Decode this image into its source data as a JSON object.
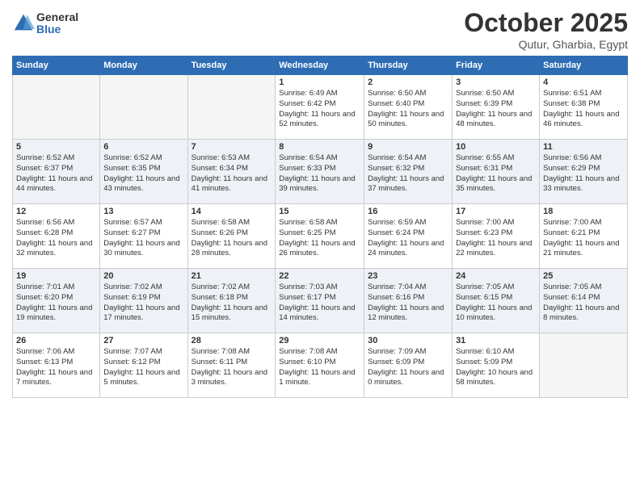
{
  "header": {
    "logo_general": "General",
    "logo_blue": "Blue",
    "month": "October 2025",
    "location": "Qutur, Gharbia, Egypt"
  },
  "weekdays": [
    "Sunday",
    "Monday",
    "Tuesday",
    "Wednesday",
    "Thursday",
    "Friday",
    "Saturday"
  ],
  "rows": [
    {
      "cells": [
        {
          "empty": true
        },
        {
          "empty": true
        },
        {
          "empty": true
        },
        {
          "day": "1",
          "sunrise": "6:49 AM",
          "sunset": "6:42 PM",
          "daylight": "11 hours and 52 minutes."
        },
        {
          "day": "2",
          "sunrise": "6:50 AM",
          "sunset": "6:40 PM",
          "daylight": "11 hours and 50 minutes."
        },
        {
          "day": "3",
          "sunrise": "6:50 AM",
          "sunset": "6:39 PM",
          "daylight": "11 hours and 48 minutes."
        },
        {
          "day": "4",
          "sunrise": "6:51 AM",
          "sunset": "6:38 PM",
          "daylight": "11 hours and 46 minutes."
        }
      ]
    },
    {
      "cells": [
        {
          "day": "5",
          "sunrise": "6:52 AM",
          "sunset": "6:37 PM",
          "daylight": "11 hours and 44 minutes."
        },
        {
          "day": "6",
          "sunrise": "6:52 AM",
          "sunset": "6:35 PM",
          "daylight": "11 hours and 43 minutes."
        },
        {
          "day": "7",
          "sunrise": "6:53 AM",
          "sunset": "6:34 PM",
          "daylight": "11 hours and 41 minutes."
        },
        {
          "day": "8",
          "sunrise": "6:54 AM",
          "sunset": "6:33 PM",
          "daylight": "11 hours and 39 minutes."
        },
        {
          "day": "9",
          "sunrise": "6:54 AM",
          "sunset": "6:32 PM",
          "daylight": "11 hours and 37 minutes."
        },
        {
          "day": "10",
          "sunrise": "6:55 AM",
          "sunset": "6:31 PM",
          "daylight": "11 hours and 35 minutes."
        },
        {
          "day": "11",
          "sunrise": "6:56 AM",
          "sunset": "6:29 PM",
          "daylight": "11 hours and 33 minutes."
        }
      ]
    },
    {
      "cells": [
        {
          "day": "12",
          "sunrise": "6:56 AM",
          "sunset": "6:28 PM",
          "daylight": "11 hours and 32 minutes."
        },
        {
          "day": "13",
          "sunrise": "6:57 AM",
          "sunset": "6:27 PM",
          "daylight": "11 hours and 30 minutes."
        },
        {
          "day": "14",
          "sunrise": "6:58 AM",
          "sunset": "6:26 PM",
          "daylight": "11 hours and 28 minutes."
        },
        {
          "day": "15",
          "sunrise": "6:58 AM",
          "sunset": "6:25 PM",
          "daylight": "11 hours and 26 minutes."
        },
        {
          "day": "16",
          "sunrise": "6:59 AM",
          "sunset": "6:24 PM",
          "daylight": "11 hours and 24 minutes."
        },
        {
          "day": "17",
          "sunrise": "7:00 AM",
          "sunset": "6:23 PM",
          "daylight": "11 hours and 22 minutes."
        },
        {
          "day": "18",
          "sunrise": "7:00 AM",
          "sunset": "6:21 PM",
          "daylight": "11 hours and 21 minutes."
        }
      ]
    },
    {
      "cells": [
        {
          "day": "19",
          "sunrise": "7:01 AM",
          "sunset": "6:20 PM",
          "daylight": "11 hours and 19 minutes."
        },
        {
          "day": "20",
          "sunrise": "7:02 AM",
          "sunset": "6:19 PM",
          "daylight": "11 hours and 17 minutes."
        },
        {
          "day": "21",
          "sunrise": "7:02 AM",
          "sunset": "6:18 PM",
          "daylight": "11 hours and 15 minutes."
        },
        {
          "day": "22",
          "sunrise": "7:03 AM",
          "sunset": "6:17 PM",
          "daylight": "11 hours and 14 minutes."
        },
        {
          "day": "23",
          "sunrise": "7:04 AM",
          "sunset": "6:16 PM",
          "daylight": "11 hours and 12 minutes."
        },
        {
          "day": "24",
          "sunrise": "7:05 AM",
          "sunset": "6:15 PM",
          "daylight": "11 hours and 10 minutes."
        },
        {
          "day": "25",
          "sunrise": "7:05 AM",
          "sunset": "6:14 PM",
          "daylight": "11 hours and 8 minutes."
        }
      ]
    },
    {
      "cells": [
        {
          "day": "26",
          "sunrise": "7:06 AM",
          "sunset": "6:13 PM",
          "daylight": "11 hours and 7 minutes."
        },
        {
          "day": "27",
          "sunrise": "7:07 AM",
          "sunset": "6:12 PM",
          "daylight": "11 hours and 5 minutes."
        },
        {
          "day": "28",
          "sunrise": "7:08 AM",
          "sunset": "6:11 PM",
          "daylight": "11 hours and 3 minutes."
        },
        {
          "day": "29",
          "sunrise": "7:08 AM",
          "sunset": "6:10 PM",
          "daylight": "11 hours and 1 minute."
        },
        {
          "day": "30",
          "sunrise": "7:09 AM",
          "sunset": "6:09 PM",
          "daylight": "11 hours and 0 minutes."
        },
        {
          "day": "31",
          "sunrise": "6:10 AM",
          "sunset": "5:09 PM",
          "daylight": "10 hours and 58 minutes."
        },
        {
          "empty": true
        }
      ]
    }
  ]
}
